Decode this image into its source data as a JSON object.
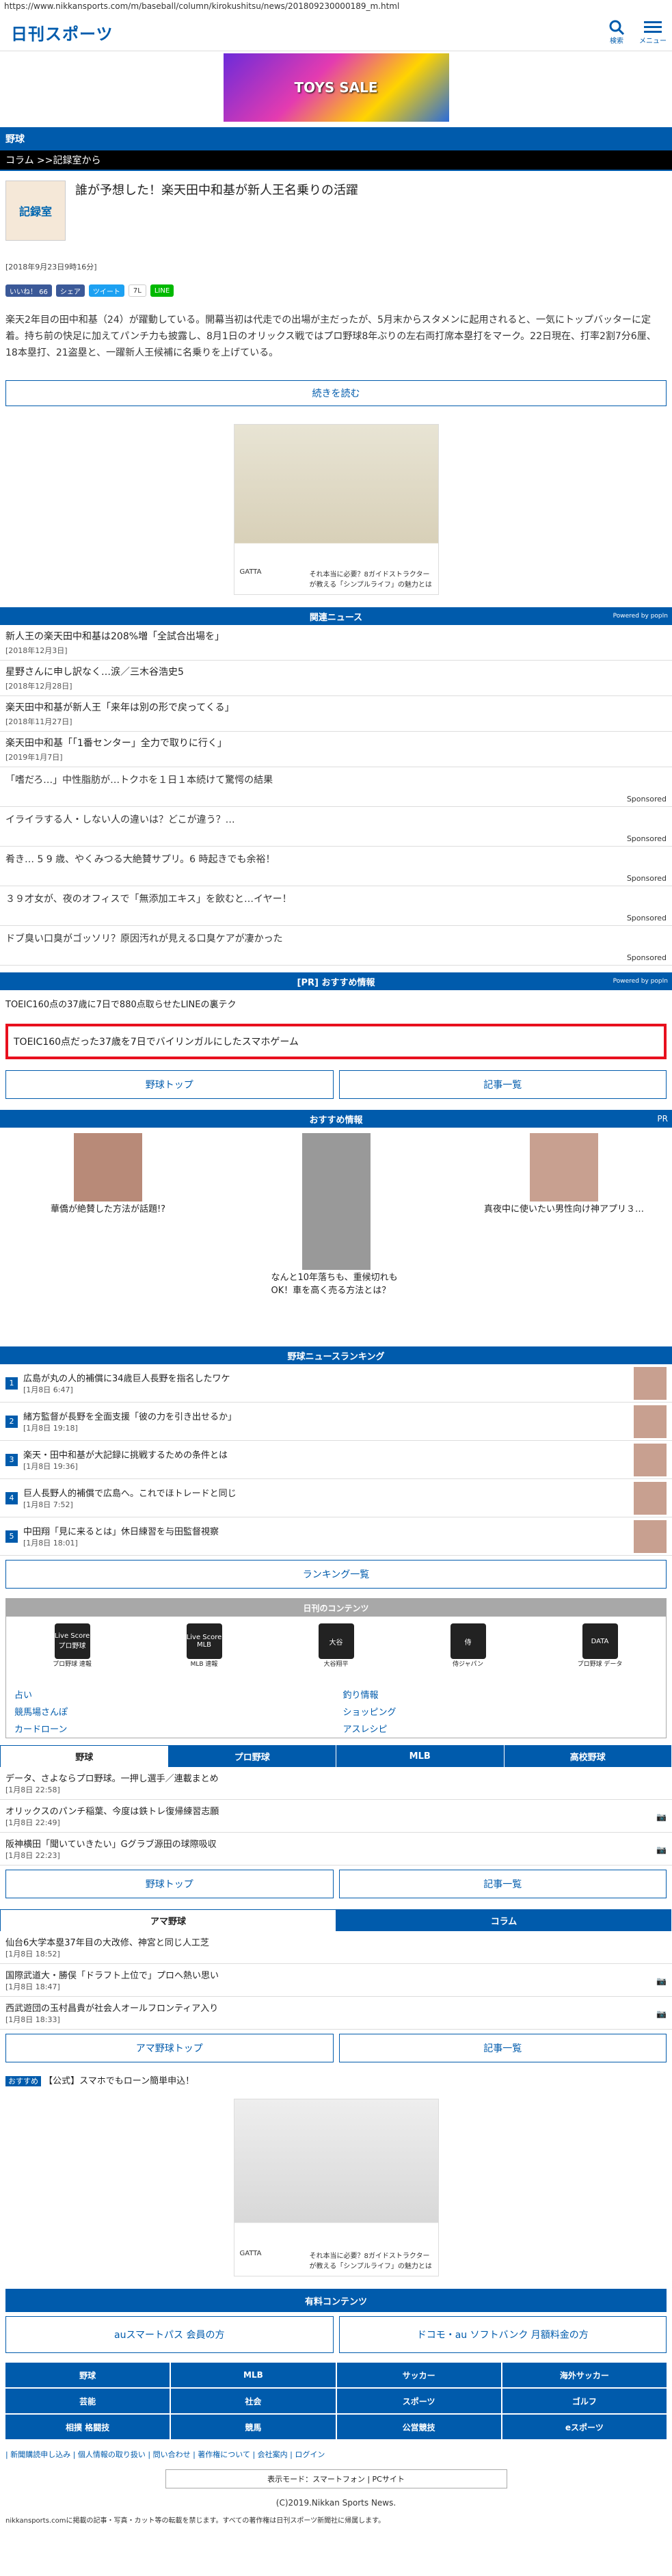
{
  "url": "https://www.nikkansports.com/m/baseball/column/kirokushitsu/news/201809230000189_m.html",
  "logo": "日刊スポーツ",
  "search_label": "検索",
  "menu_label": "メニュー",
  "banner_text": "TOYS SALE",
  "section": "野球",
  "breadcrumb": "コラム >>記録室から",
  "thumb_text": "記録室",
  "article_title": "誰が予想した！楽天田中和基が新人王名乗りの活躍",
  "article_date": "[2018年9月23日9時16分]",
  "share": {
    "like": "いいね！ 66",
    "share": "シェア",
    "tweet": "ツイート",
    "count": "7L",
    "line": "LINE"
  },
  "body": "楽天2年目の田中和基（24）が躍動している。開幕当初は代走での出場が主だったが、5月末からスタメンに起用されると、一気にトップバッターに定着。持ち前の快足に加えてパンチ力も披露し、8月1日のオリックス戦ではプロ野球8年ぶりの左右両打席本塁打をマーク。22日現在、打率2割7分6厘、18本塁打、21盗塁と、一躍新人王候補に名乗りを上げている。",
  "more_button": "続きを読む",
  "ad_brand": "GATTA",
  "ad_text": "それ本当に必要？8ガイドストラクターが教える「シンプルライフ」の魅力とは",
  "related_title": "関連ニュース",
  "powered": "Powered by popIn",
  "related": [
    {
      "t": "新人王の楽天田中和基は208%増「全試合出場を」",
      "d": "[2018年12月3日]"
    },
    {
      "t": "星野さんに申し訳なく…涙／三木谷浩史5",
      "d": "[2018年12月28日]"
    },
    {
      "t": "楽天田中和基が新人王「来年は別の形で戻ってくる」",
      "d": "[2018年11月27日]"
    },
    {
      "t": "楽天田中和基「「1番センター」全力で取りに行く」",
      "d": "[2019年1月7日]"
    }
  ],
  "sponsored": [
    {
      "t": "「嗜だろ…」中性脂肪が…トクホを１日１本続けて驚愕の結果",
      "s": "Sponsored"
    },
    {
      "t": "イライラする人・しない人の違いは？どこが違う？…",
      "s": "Sponsored"
    },
    {
      "t": "肴き… 5 9 歳、やくみつる大絶賛サプリ。6 時起きでも余裕！",
      "s": "Sponsored"
    },
    {
      "t": "３９才女が、夜のオフィスで「無添加エキス」を飲むと…イヤー！",
      "s": "Sponsored"
    },
    {
      "t": "ドブ臭い口臭がゴッソリ？原因汚れが見える口臭ケアが凄かった",
      "s": "Sponsored"
    }
  ],
  "pr_title": "[PR] おすすめ情報",
  "pr_line": "TOEIC160点の37歳に7日で880点取らせたLINEの裏テク",
  "red_box": "TOEIC160点だった37歳を7日でバイリンガルにしたスマホゲーム",
  "btn_baseball_top": "野球トップ",
  "btn_article_list": "記事一覧",
  "reco_title": "おすすめ情報",
  "reco_pr": "PR",
  "reco": [
    {
      "t": "華僑が絶賛した方法が話題!?"
    },
    {
      "t": "なんと10年落ちも、重候切れもOK！車を高く売る方法とは？"
    },
    {
      "t": "真夜中に使いたい男性向け神アプリ３…"
    }
  ],
  "ranking_title": "野球ニュースランキング",
  "ranking": [
    {
      "n": "1",
      "t": "広島が丸の人的補償に34歳巨人長野を指名したワケ",
      "d": "[1月8日 6:47]"
    },
    {
      "n": "2",
      "t": "緒方監督が長野を全面支援「彼の力を引き出せるか」",
      "d": "[1月8日 19:18]"
    },
    {
      "n": "3",
      "t": "楽天・田中和基が大記録に挑戦するための条件とは",
      "d": "[1月8日 19:36]"
    },
    {
      "n": "4",
      "t": "巨人長野人的補償で広島へ。これでほトレードと同じ",
      "d": "[1月8日 7:52]"
    },
    {
      "n": "5",
      "t": "中田翔「見に来るとは」休日練習を与田監督視察",
      "d": "[1月8日 18:01]"
    }
  ],
  "ranking_button": "ランキング一覧",
  "paid_title": "日刊のコンテンツ",
  "paid": [
    {
      "icon": "Live Score プロ野球",
      "l": "プロ野球 速報"
    },
    {
      "icon": "Live Score MLB",
      "l": "MLB 速報"
    },
    {
      "icon": "大谷",
      "l": "大谷翔平"
    },
    {
      "icon": "侍",
      "l": "侍ジャパン"
    },
    {
      "icon": "DATA",
      "l": "プロ野球 データ"
    }
  ],
  "links": [
    "占い",
    "釣り情報",
    "競馬場さんぽ",
    "ショッピング",
    "カードローン",
    "アスレシピ"
  ],
  "tabs1": [
    "野球",
    "プロ野球",
    "MLB",
    "高校野球"
  ],
  "list1": [
    {
      "t": "データ、さよならプロ野球。一押し選手／連載まとめ",
      "d": "[1月8日 22:58]"
    },
    {
      "t": "オリックスのパンチ稲葉、今度は鉄トレ復帰練習志願",
      "d": "[1月8日 22:49]"
    },
    {
      "t": "阪神横田「聞いていきたい」Gグラブ源田の球際吸収",
      "d": "[1月8日 22:23]"
    }
  ],
  "tabs2": [
    "アマ野球",
    "コラム"
  ],
  "list2": [
    {
      "t": "仙台6大学本塁37年目の大改修、神宮と同じ人工芝",
      "d": "[1月8日 18:52]"
    },
    {
      "t": "国際武道大・勝俣「ドラフト上位で」プロへ熱い思い",
      "d": "[1月8日 18:47]"
    },
    {
      "t": "西武遊団の玉村昌貴が社会人オールフロンティア入り",
      "d": "[1月8日 18:33]"
    }
  ],
  "btn_ama_top": "アマ野球トップ",
  "osusume": "おすすめ",
  "osusume_text": "【公式】スマホでもローン簡単申込！",
  "yuryou_title": "有料コンテンツ",
  "au_btn": "auスマートパス 会員の方",
  "docomo_btn": "ドコモ・au ソフトバンク 月額料金の方",
  "footer_nav": [
    "野球",
    "MLB",
    "サッカー",
    "海外サッカー",
    "芸能",
    "社会",
    "スポーツ",
    "ゴルフ",
    "相撲 格闘技",
    "競馬",
    "公営競技",
    "eスポーツ"
  ],
  "bottom_links": "| 新聞購読申し込み | 個人情報の取り扱い | 問い合わせ | 著作権について | 会社案内 | ログイン",
  "mode": "表示モード：スマートフォン | PCサイト",
  "copyright": "(C)2019.Nikkan Sports News.",
  "small_notice": "nikkansports.comに掲載の記事・写真・カット等の転載を禁じます。すべての著作権は日刊スポーツ新聞社に帰属します。"
}
